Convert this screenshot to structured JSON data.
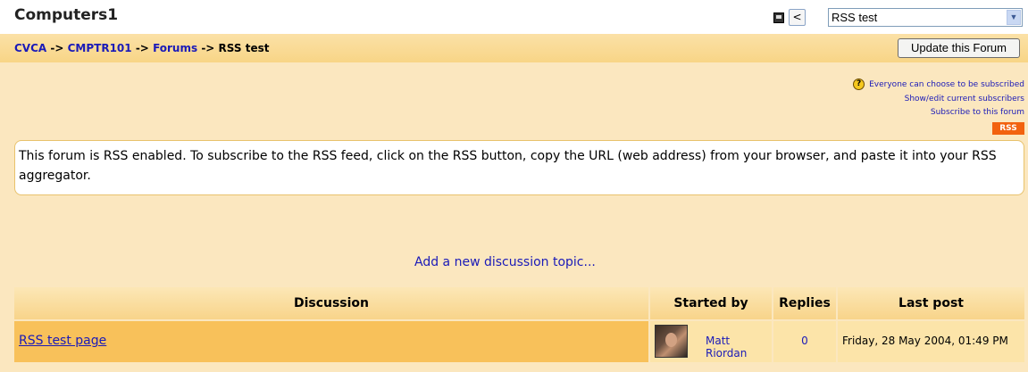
{
  "header": {
    "site_title": "Computers1",
    "jump_prev_label": "<",
    "forum_select_value": "RSS test"
  },
  "breadcrumb": {
    "items": [
      "CVCA",
      "CMPTR101",
      "Forums",
      "RSS test"
    ],
    "separator": "->"
  },
  "toolbar": {
    "update_label": "Update this Forum"
  },
  "subscription": {
    "help_label": "?",
    "mode_text": "Everyone can choose to be subscribed",
    "show_edit_label": "Show/edit current subscribers",
    "subscribe_label": "Subscribe to this forum",
    "rss_label": "RSS"
  },
  "intro": {
    "text": "This forum is RSS enabled. To subscribe to the RSS feed, click on the RSS button, copy the URL (web address) from your browser, and paste it into your RSS aggregator."
  },
  "add_topic_label": "Add a new discussion topic...",
  "table": {
    "headers": {
      "discussion": "Discussion",
      "started_by": "Started by",
      "replies": "Replies",
      "last_post": "Last post"
    },
    "rows": [
      {
        "topic": "RSS test page",
        "started_by": "Matt Riordan",
        "replies": "0",
        "last_post": "Friday, 28 May 2004, 01:49 PM"
      }
    ]
  },
  "colors": {
    "link": "#1a1ab8",
    "page_background": "#fbe7bf",
    "highlight_row": "#f8c15a",
    "rss_badge": "#f2620f"
  }
}
